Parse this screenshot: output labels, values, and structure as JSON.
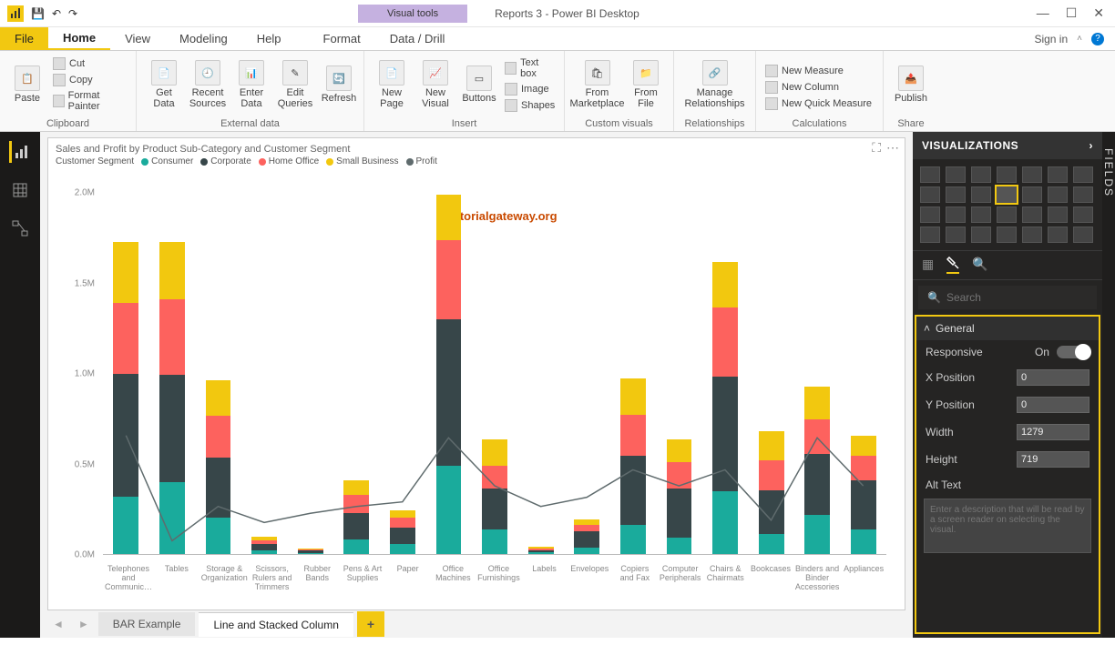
{
  "window": {
    "title": "Reports 3 - Power BI Desktop",
    "visual_tools": "Visual tools",
    "sign_in": "Sign in"
  },
  "menu": {
    "file": "File",
    "home": "Home",
    "view": "View",
    "modeling": "Modeling",
    "hhelp": "Help",
    "format": "Format",
    "datadrill": "Data / Drill"
  },
  "ribbon": {
    "clipboard": {
      "label": "Clipboard",
      "paste": "Paste",
      "cut": "Cut",
      "copy": "Copy",
      "painter": "Format Painter"
    },
    "external": {
      "label": "External data",
      "get": "Get\nData",
      "recent": "Recent\nSources",
      "enter": "Enter\nData",
      "edit": "Edit\nQueries",
      "refresh": "Refresh"
    },
    "insert": {
      "label": "Insert",
      "npage": "New\nPage",
      "nvisual": "New\nVisual",
      "buttons": "Buttons",
      "textbox": "Text box",
      "image": "Image",
      "shapes": "Shapes"
    },
    "custom": {
      "label": "Custom visuals",
      "market": "From\nMarketplace",
      "file": "From\nFile"
    },
    "rel": {
      "label": "Relationships",
      "manage": "Manage\nRelationships"
    },
    "calc": {
      "label": "Calculations",
      "nm": "New Measure",
      "nc": "New Column",
      "nqm": "New Quick Measure"
    },
    "share": {
      "label": "Share",
      "publish": "Publish"
    }
  },
  "chart": {
    "title": "Sales and Profit by Product Sub-Category and Customer Segment",
    "legend_label": "Customer Segment",
    "watermark": "©tutorialgateway.org"
  },
  "chart_data": {
    "type": "bar",
    "stacked": true,
    "ylabel": "",
    "ylim": [
      0,
      2200000
    ],
    "yticks": [
      "0.0M",
      "0.5M",
      "1.0M",
      "1.5M",
      "2.0M"
    ],
    "categories": [
      "Telephones and Communic…",
      "Tables",
      "Storage & Organization",
      "Scissors, Rulers and Trimmers",
      "Rubber Bands",
      "Pens & Art Supplies",
      "Paper",
      "Office Machines",
      "Office Furnishings",
      "Labels",
      "Envelopes",
      "Copiers and Fax",
      "Computer Peripherals",
      "Chairs & Chairmats",
      "Bookcases",
      "Binders and Binder Accessories",
      "Appliances"
    ],
    "series": [
      {
        "name": "Consumer",
        "color": "#1aab9c",
        "values": [
          350000,
          440000,
          220000,
          20000,
          5000,
          90000,
          60000,
          540000,
          150000,
          10000,
          40000,
          180000,
          100000,
          380000,
          120000,
          240000,
          150000
        ]
      },
      {
        "name": "Corporate",
        "color": "#374649",
        "values": [
          750000,
          650000,
          370000,
          40000,
          15000,
          160000,
          100000,
          890000,
          250000,
          15000,
          100000,
          420000,
          300000,
          700000,
          270000,
          370000,
          300000
        ]
      },
      {
        "name": "Home Office",
        "color": "#fd625e",
        "values": [
          430000,
          460000,
          250000,
          25000,
          10000,
          110000,
          60000,
          480000,
          140000,
          10000,
          40000,
          250000,
          160000,
          420000,
          180000,
          210000,
          150000
        ]
      },
      {
        "name": "Small Business",
        "color": "#f2c80f",
        "values": [
          370000,
          350000,
          220000,
          20000,
          5000,
          90000,
          45000,
          280000,
          160000,
          10000,
          30000,
          220000,
          140000,
          280000,
          180000,
          200000,
          120000
        ]
      }
    ],
    "profit_line": {
      "name": "Profit",
      "color": "#5f6b6d",
      "values": [
        330000,
        -130000,
        20000,
        -50000,
        -10000,
        20000,
        40000,
        320000,
        110000,
        20000,
        60000,
        180000,
        110000,
        180000,
        -40000,
        320000,
        110000
      ]
    }
  },
  "tabs": {
    "t1": "BAR Example",
    "t2": "Line and Stacked Column"
  },
  "vis": {
    "header": "VISUALIZATIONS",
    "search_ph": "Search",
    "general": "General",
    "responsive": "Responsive",
    "responsive_val": "On",
    "xpos": "X Position",
    "xpos_val": "0",
    "ypos": "Y Position",
    "ypos_val": "0",
    "width": "Width",
    "width_val": "1279",
    "height": "Height",
    "height_val": "719",
    "alt": "Alt Text",
    "alt_ph": "Enter a description that will be read by a screen reader on selecting the visual."
  },
  "fields": {
    "label": "FIELDS"
  }
}
